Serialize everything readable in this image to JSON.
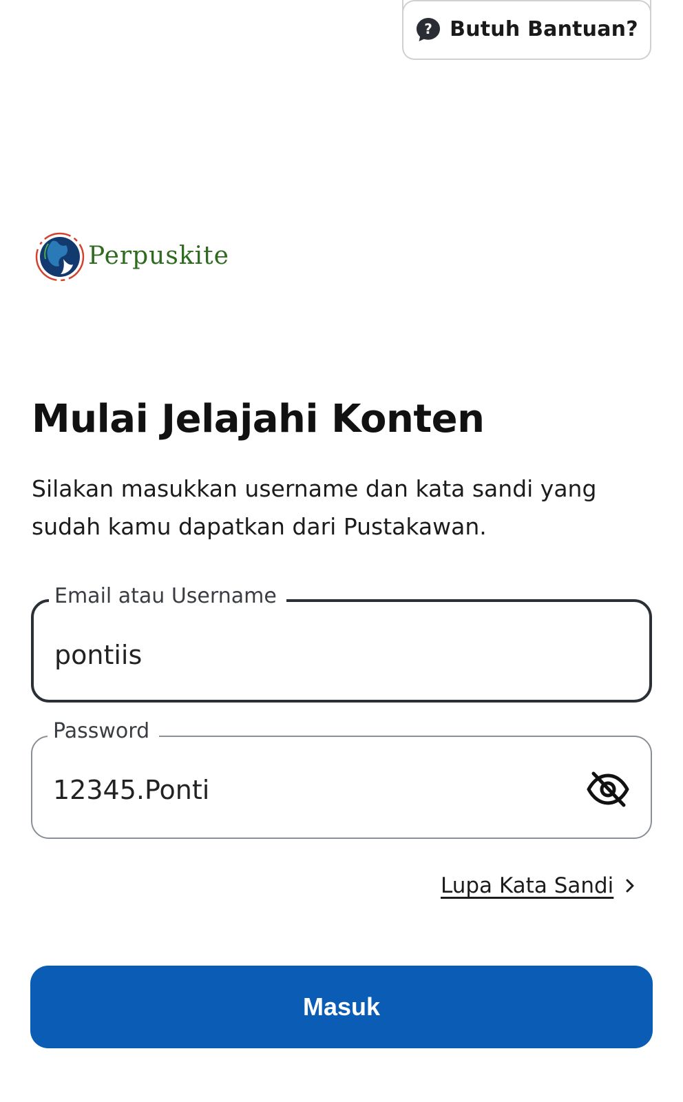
{
  "help": {
    "label": "Butuh Bantuan?",
    "icon": "question-bubble-icon"
  },
  "logo": {
    "text": "Perpuskite",
    "icon": "perpuskite-globe-logo",
    "text_color": "#2e6b1f"
  },
  "heading": {
    "title": "Mulai Jelajahi Konten"
  },
  "intro": {
    "text": "Silakan masukkan username dan kata sandi yang sudah kamu dapatkan dari Pustakawan."
  },
  "form": {
    "email": {
      "label": "Email atau Username",
      "value": "pontiis"
    },
    "password": {
      "label": "Password",
      "value": "12345.Ponti",
      "toggle_icon": "eye-off-icon"
    },
    "forgot": {
      "label": "Lupa Kata Sandi",
      "icon": "chevron-right-icon"
    },
    "submit": {
      "label": "Masuk",
      "color": "#0b5cb5"
    }
  }
}
